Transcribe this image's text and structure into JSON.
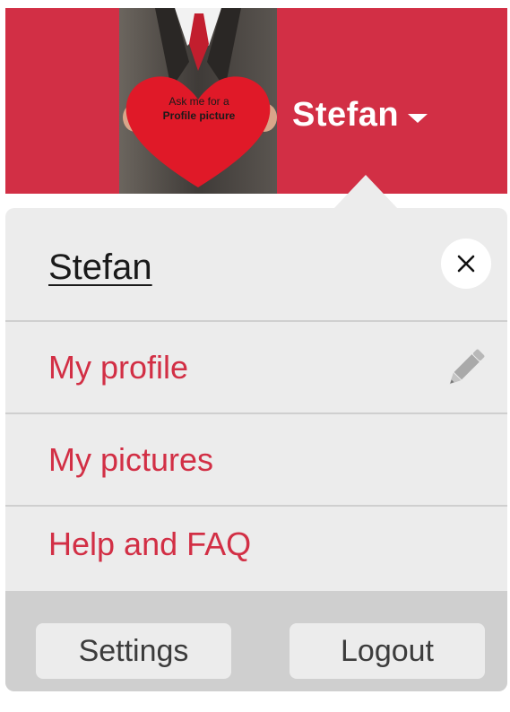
{
  "header": {
    "avatar_text_line1": "Ask me for a",
    "avatar_text_line2": "Profile picture",
    "username": "Stefan"
  },
  "menu": {
    "name": "Stefan",
    "items": [
      {
        "label": "My profile"
      },
      {
        "label": "My pictures"
      },
      {
        "label": "Help and FAQ"
      }
    ]
  },
  "footer": {
    "settings_label": "Settings",
    "logout_label": "Logout"
  },
  "colors": {
    "brand_red": "#d22f45",
    "panel_bg": "#ececec",
    "divider": "#cfcfcf"
  },
  "icons": {
    "dropdown": "caret-down-icon",
    "close": "close-icon",
    "edit": "pencil-icon"
  }
}
